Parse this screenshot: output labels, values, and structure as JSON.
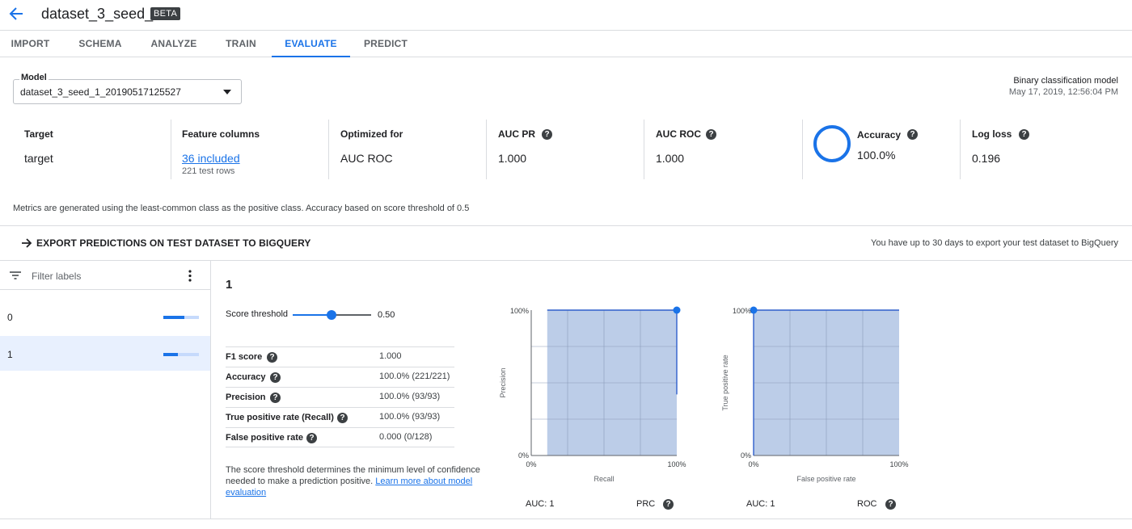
{
  "header": {
    "title": "dataset_3_seed_1",
    "badge": "BETA"
  },
  "tabs": [
    "IMPORT",
    "SCHEMA",
    "ANALYZE",
    "TRAIN",
    "EVALUATE",
    "PREDICT"
  ],
  "active_tab": "EVALUATE",
  "model": {
    "label": "Model",
    "value": "dataset_3_seed_1_20190517125527",
    "type": "Binary classification model",
    "date": "May 17, 2019, 12:56:04 PM"
  },
  "metrics": {
    "target": {
      "label": "Target",
      "value": "target"
    },
    "feature_columns": {
      "label": "Feature columns",
      "value": "36 included",
      "note": "221 test rows"
    },
    "optimized_for": {
      "label": "Optimized for",
      "value": "AUC ROC"
    },
    "auc_pr": {
      "label": "AUC PR",
      "value": "1.000"
    },
    "auc_roc": {
      "label": "AUC ROC",
      "value": "1.000"
    },
    "accuracy": {
      "label": "Accuracy",
      "value": "100.0%",
      "fraction": 1.0
    },
    "log_loss": {
      "label": "Log loss",
      "value": "0.196"
    },
    "help_glyph": "?"
  },
  "metrics_note": "Metrics are generated using the least-common class as the positive class. Accuracy based on score threshold of 0.5",
  "export": {
    "label": "EXPORT PREDICTIONS ON TEST DATASET TO BIGQUERY",
    "note": "You have up to 30 days to export your test dataset to BigQuery"
  },
  "labels_panel": {
    "filter_placeholder": "Filter labels",
    "items": [
      {
        "name": "0",
        "fraction": 0.58
      },
      {
        "name": "1",
        "fraction": 0.42
      }
    ],
    "selected": "1"
  },
  "detail": {
    "class_name": "1",
    "threshold_label": "Score threshold",
    "threshold_value": "0.50",
    "threshold": 0.5,
    "stats": [
      {
        "name": "F1 score",
        "value": "1.000"
      },
      {
        "name": "Accuracy",
        "value": "100.0% (221/221)"
      },
      {
        "name": "Precision",
        "value": "100.0% (93/93)"
      },
      {
        "name": "True positive rate (Recall)",
        "value": "100.0% (93/93)"
      },
      {
        "name": "False positive rate",
        "value": "0.000 (0/128)"
      }
    ],
    "description": "The score threshold determines the minimum level of confidence needed to make a prediction positive.",
    "learn_more": "Learn more about model evaluation"
  },
  "colors": {
    "accent": "#1a73e8",
    "curve_fill": "#bccde8",
    "curve_line": "#2f5fcc"
  },
  "chart_data": [
    {
      "type": "area",
      "name": "PRC",
      "xlabel": "Recall",
      "ylabel": "Precision",
      "x_ticks": [
        "0%",
        "100%"
      ],
      "y_ticks": [
        "0%",
        "100%"
      ],
      "xlim": [
        0,
        1
      ],
      "ylim": [
        0,
        1
      ],
      "grid": true,
      "x": [
        0.11,
        1.0,
        1.0
      ],
      "y": [
        1.0,
        1.0,
        0.42
      ],
      "marker": {
        "x": 1.0,
        "y": 1.0
      },
      "auc_label": "AUC: 1",
      "caption": "PRC"
    },
    {
      "type": "area",
      "name": "ROC",
      "xlabel": "False positive rate",
      "ylabel": "True positive rate",
      "x_ticks": [
        "0%",
        "100%"
      ],
      "y_ticks": [
        "0%",
        "100%"
      ],
      "xlim": [
        0,
        1
      ],
      "ylim": [
        0,
        1
      ],
      "grid": true,
      "x": [
        0.0,
        0.0,
        1.0
      ],
      "y": [
        0.0,
        1.0,
        1.0
      ],
      "marker": {
        "x": 0.0,
        "y": 1.0
      },
      "auc_label": "AUC: 1",
      "caption": "ROC"
    }
  ]
}
